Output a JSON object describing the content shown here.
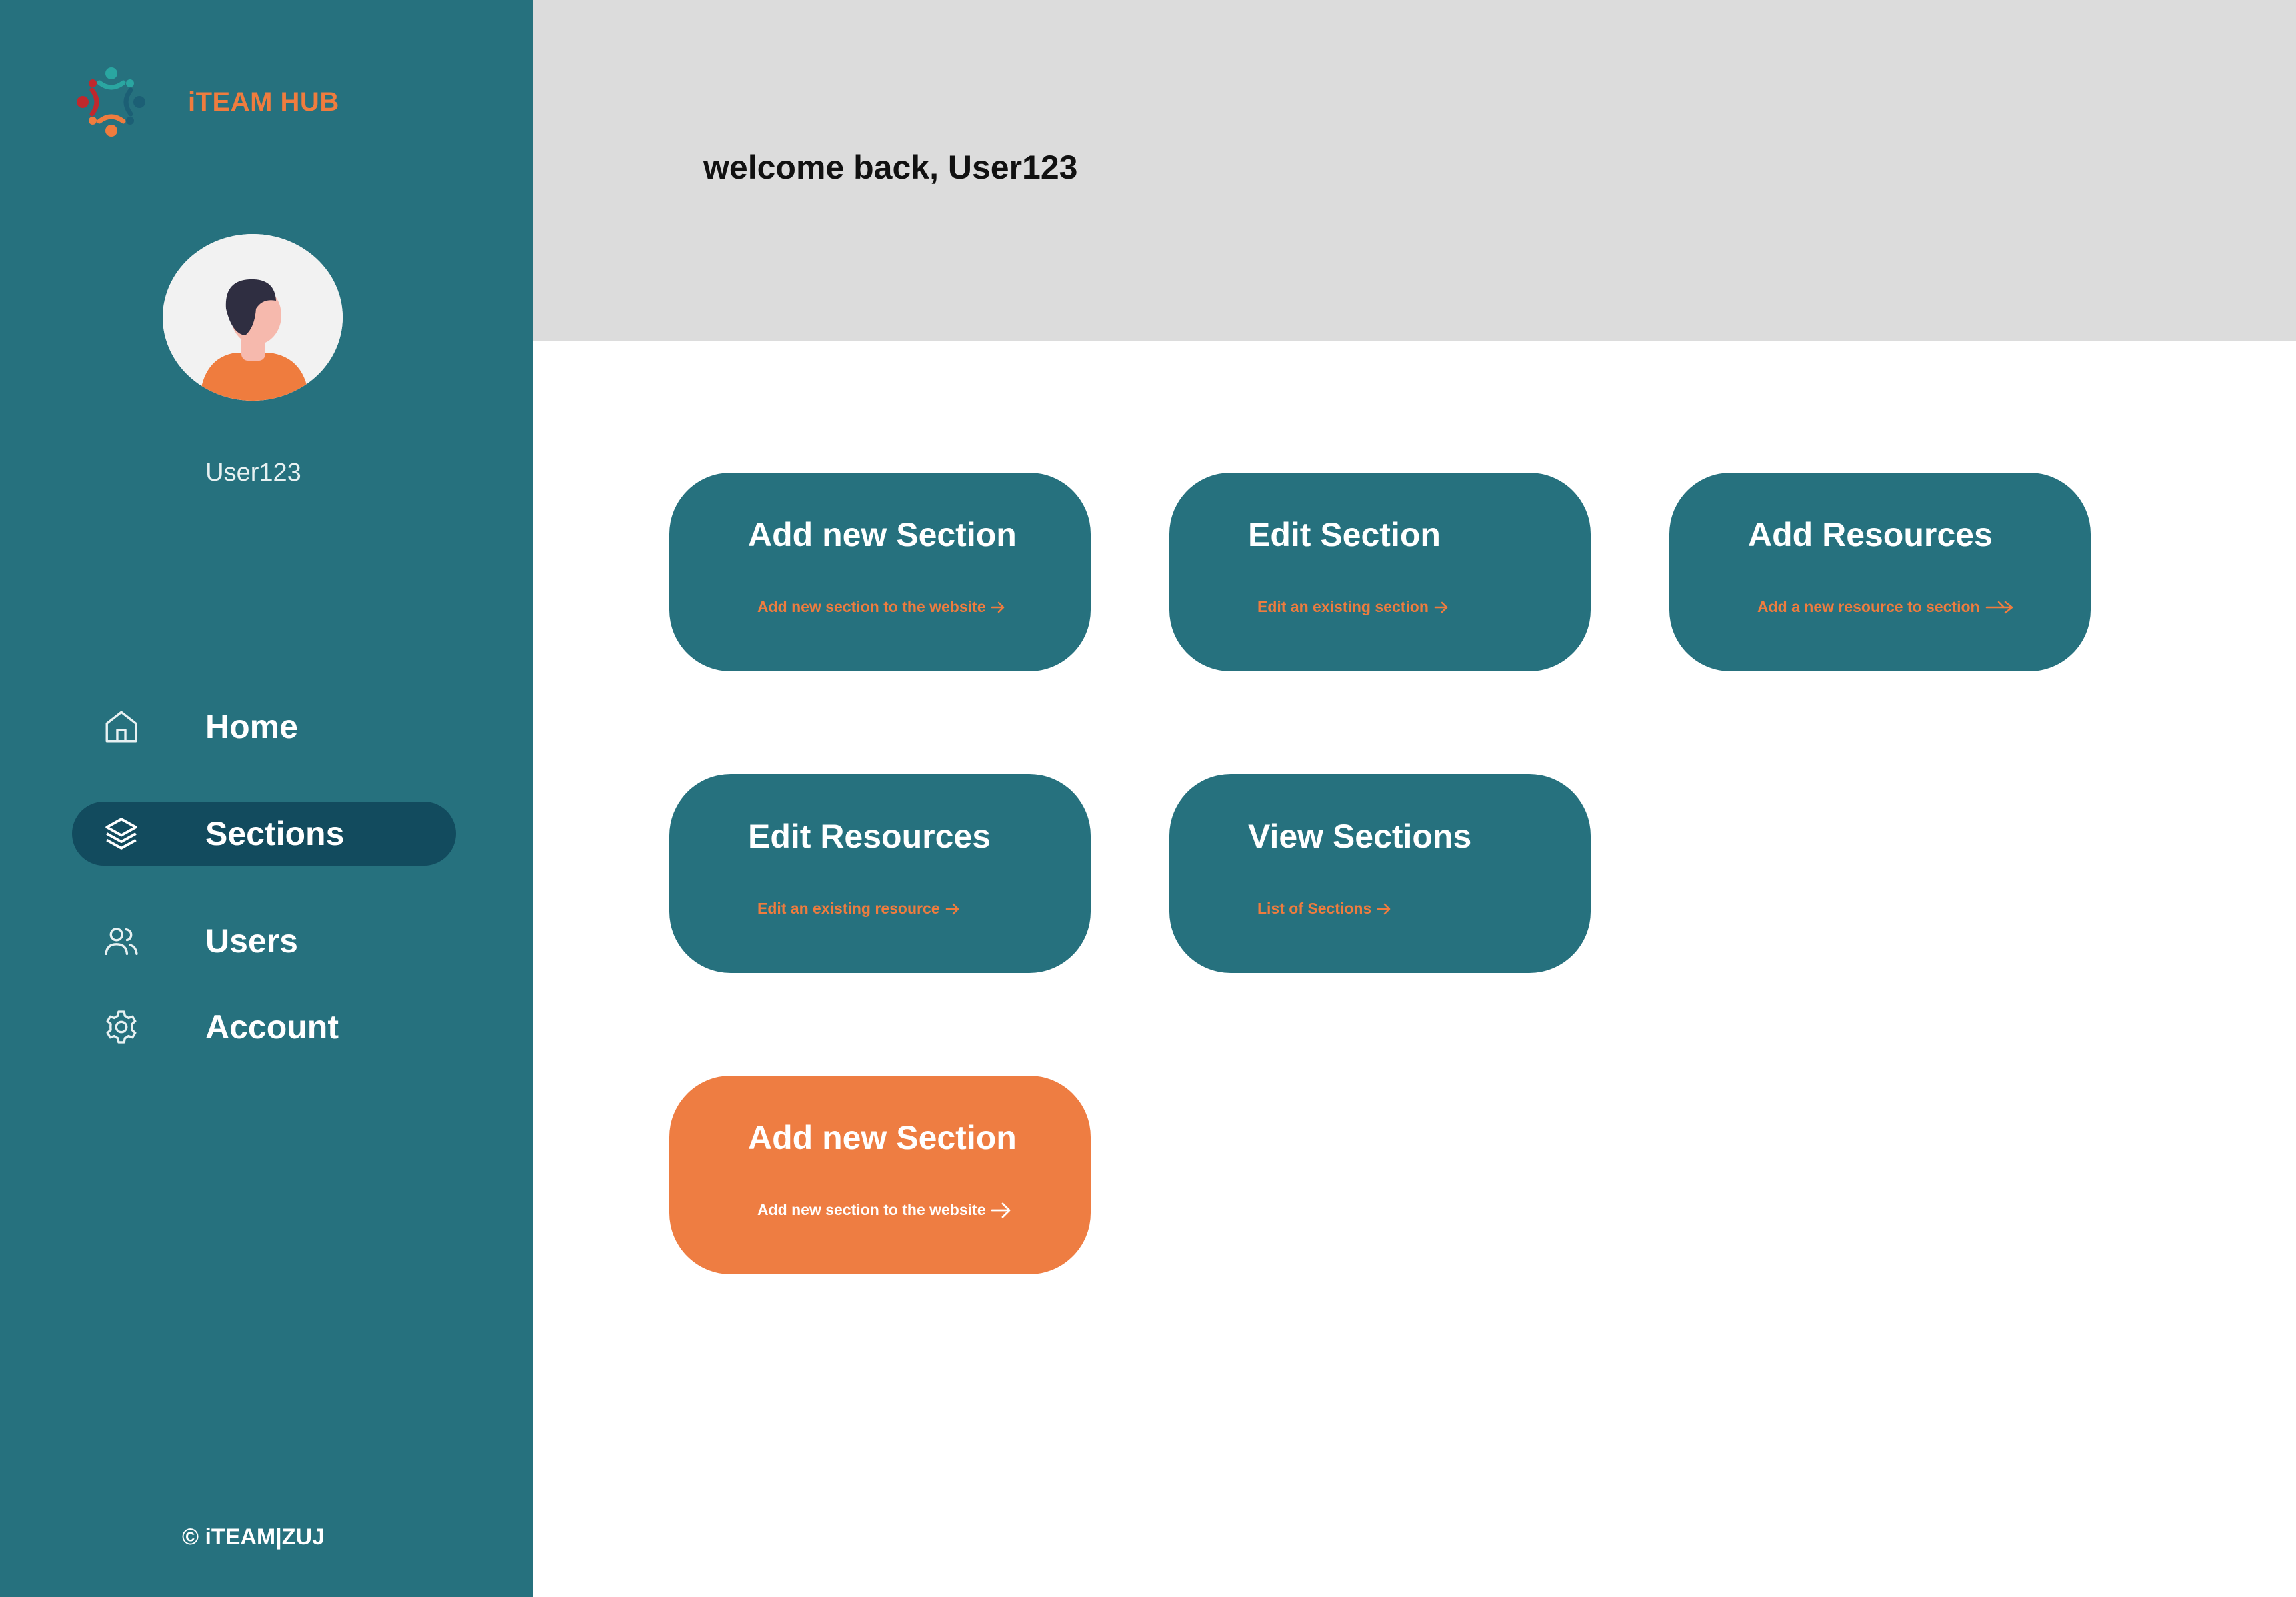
{
  "brand": {
    "name": "iTEAM HUB"
  },
  "user": {
    "name": "User123"
  },
  "nav": [
    {
      "label": "Home",
      "icon": "home-icon",
      "active": false
    },
    {
      "label": "Sections",
      "icon": "layers-icon",
      "active": true
    },
    {
      "label": "Users",
      "icon": "users-icon",
      "active": false
    },
    {
      "label": "Account",
      "icon": "gear-icon",
      "active": false
    }
  ],
  "footer": "© iTEAM|ZUJ",
  "header": {
    "welcome": "welcome back, User123"
  },
  "cards": [
    {
      "title": "Add new Section",
      "link": "Add new section to the website",
      "variant": "teal"
    },
    {
      "title": "Edit Section",
      "link": "Edit an existing section",
      "variant": "teal"
    },
    {
      "title": "Add Resources",
      "link": "Add a new resource to section",
      "variant": "teal"
    },
    {
      "title": "Edit Resources",
      "link": "Edit an existing resource",
      "variant": "teal"
    },
    {
      "title": "View Sections",
      "link": "List of Sections",
      "variant": "teal"
    },
    {
      "title": "Add new Section",
      "link": "Add new section to the website",
      "variant": "orange"
    }
  ],
  "colors": {
    "sidebar": "#26717e",
    "active_nav": "#124b5e",
    "accent_orange": "#ee7d42",
    "header_bg": "#dcdcdc"
  }
}
